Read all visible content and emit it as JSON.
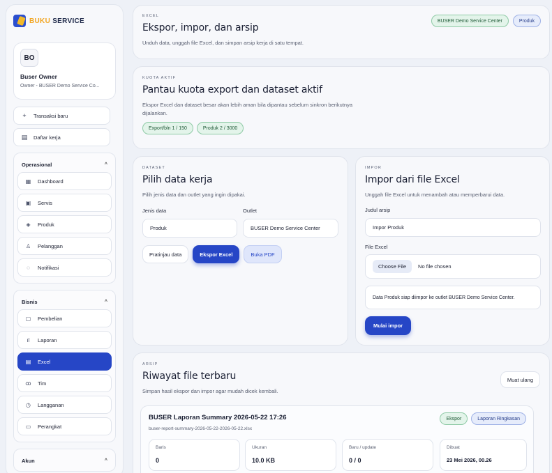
{
  "brand": {
    "part1": "BUKU",
    "part2": "SERVICE"
  },
  "profile": {
    "initials": "BO",
    "name": "Buser Owner",
    "subtitle": "Owner - BUSER Demo Service Co..."
  },
  "quick_actions": [
    {
      "label": "Transaksi baru",
      "icon": "plus-icon"
    },
    {
      "label": "Daftar kerja",
      "icon": "clipboard-icon"
    }
  ],
  "nav": {
    "operasional": {
      "title": "Operasional",
      "items": [
        "Dashboard",
        "Servis",
        "Produk",
        "Pelanggan",
        "Notifikasi"
      ]
    },
    "bisnis": {
      "title": "Bisnis",
      "items": [
        "Pembelian",
        "Laporan",
        "Excel",
        "Tim",
        "Langganan",
        "Perangkat"
      ]
    },
    "akun": {
      "title": "Akun"
    }
  },
  "header": {
    "kicker": "EXCEL",
    "title": "Ekspor, impor, dan arsip",
    "desc": "Unduh data, unggah file Excel, dan simpan arsip kerja di satu tempat.",
    "badge_outlet": "BUSER Demo Service Center",
    "badge_type": "Produk"
  },
  "quota": {
    "kicker": "KUOTA AKTIF",
    "title": "Pantau kuota export dan dataset aktif",
    "desc_line1": "Ekspor Excel dan dataset besar akan lebih aman bila dipantau sebelum sinkron berikutnya",
    "desc_line2": "dijalankan.",
    "pill_export": "Export/bln 1 / 150",
    "pill_produk": "Produk 2 / 3000"
  },
  "dataset": {
    "kicker": "DATASET",
    "title": "Pilih data kerja",
    "desc": "Pilih jenis data dan outlet yang ingin dipakai.",
    "jenis_label": "Jenis data",
    "jenis_value": "Produk",
    "outlet_label": "Outlet",
    "outlet_value": "BUSER Demo Service Center",
    "btn_preview": "Pratinjau data",
    "btn_export": "Ekspor Excel",
    "btn_pdf": "Buka PDF"
  },
  "impor": {
    "kicker": "IMPOR",
    "title": "Impor dari file Excel",
    "desc": "Unggah file Excel untuk menambah atau memperbarui data.",
    "judul_label": "Judul arsip",
    "judul_value": "Impor Produk",
    "file_label": "File Excel",
    "choose_btn": "Choose File",
    "no_file": "No file chosen",
    "info": "Data Produk siap diimpor ke outlet BUSER Demo Service Center.",
    "btn_start": "Mulai impor"
  },
  "arsip": {
    "kicker": "ARSIP",
    "title": "Riwayat file terbaru",
    "desc": "Simpan hasil ekspor dan impor agar mudah dicek kembali.",
    "btn_reload": "Muat ulang",
    "entry": {
      "title": "BUSER Laporan Summary 2026-05-22 17:26",
      "filename": "buser-report-summary-2026-05-22-2026-05-22.xlsx",
      "tag1": "Ekspor",
      "tag2": "Laporan Ringkasan",
      "stats": [
        {
          "label": "Baris",
          "value": "0"
        },
        {
          "label": "Ukuran",
          "value": "10.0 KB"
        },
        {
          "label": "Baru / update",
          "value": "0 / 0"
        },
        {
          "label": "Dibuat",
          "value": "23 Mei 2026, 00.26"
        }
      ]
    }
  }
}
